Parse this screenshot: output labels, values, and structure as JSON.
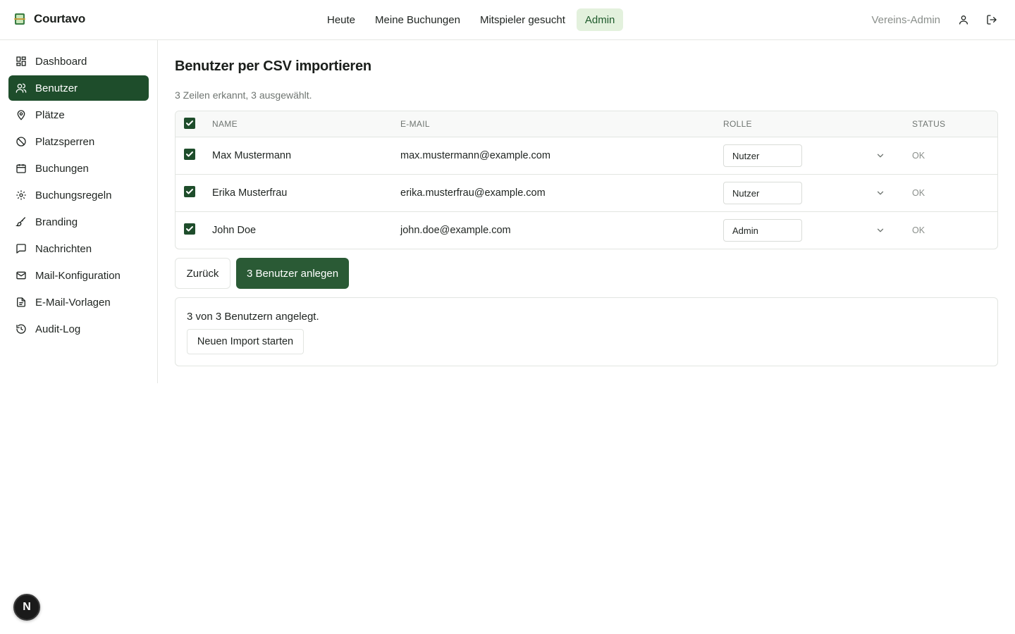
{
  "app": {
    "name": "Courtavo"
  },
  "topnav": {
    "items": [
      {
        "label": "Heute",
        "active": false
      },
      {
        "label": "Meine Buchungen",
        "active": false
      },
      {
        "label": "Mitspieler gesucht",
        "active": false
      },
      {
        "label": "Admin",
        "active": true
      }
    ]
  },
  "user": {
    "role_label": "Vereins-Admin",
    "profile_icon": "user-icon",
    "logout_icon": "logout-icon"
  },
  "sidebar": {
    "items": [
      {
        "label": "Dashboard",
        "icon": "dashboard-icon",
        "active": false
      },
      {
        "label": "Benutzer",
        "icon": "users-icon",
        "active": true
      },
      {
        "label": "Plätze",
        "icon": "map-pin-icon",
        "active": false
      },
      {
        "label": "Platzsperren",
        "icon": "ban-icon",
        "active": false
      },
      {
        "label": "Buchungen",
        "icon": "calendar-icon",
        "active": false
      },
      {
        "label": "Buchungsregeln",
        "icon": "gear-icon",
        "active": false
      },
      {
        "label": "Branding",
        "icon": "brush-icon",
        "active": false
      },
      {
        "label": "Nachrichten",
        "icon": "message-icon",
        "active": false
      },
      {
        "label": "Mail-Konfiguration",
        "icon": "mail-icon",
        "active": false
      },
      {
        "label": "E-Mail-Vorlagen",
        "icon": "document-icon",
        "active": false
      },
      {
        "label": "Audit-Log",
        "icon": "history-icon",
        "active": false
      }
    ]
  },
  "page": {
    "title": "Benutzer per CSV importieren",
    "subtitle": "3 Zeilen erkannt, 3 ausgewählt."
  },
  "table": {
    "headers": {
      "name": "NAME",
      "email": "E-MAIL",
      "role": "ROLLE",
      "status": "STATUS"
    },
    "select_all_checked": true,
    "rows": [
      {
        "checked": true,
        "name": "Max Mustermann",
        "email": "max.mustermann@example.com",
        "role": "Nutzer",
        "status": "OK"
      },
      {
        "checked": true,
        "name": "Erika Musterfrau",
        "email": "erika.musterfrau@example.com",
        "role": "Nutzer",
        "status": "OK"
      },
      {
        "checked": true,
        "name": "John Doe",
        "email": "john.doe@example.com",
        "role": "Admin",
        "status": "OK"
      }
    ]
  },
  "actions": {
    "back_label": "Zurück",
    "create_label": "3 Benutzer anlegen"
  },
  "result": {
    "text": "3 von 3 Benutzern angelegt.",
    "restart_label": "Neuen Import starten"
  },
  "dev_badge": {
    "label": "N"
  },
  "colors": {
    "primary": "#1e4d2b",
    "active_nav_bg": "#e3f1dd",
    "muted": "#8a8f8b"
  }
}
